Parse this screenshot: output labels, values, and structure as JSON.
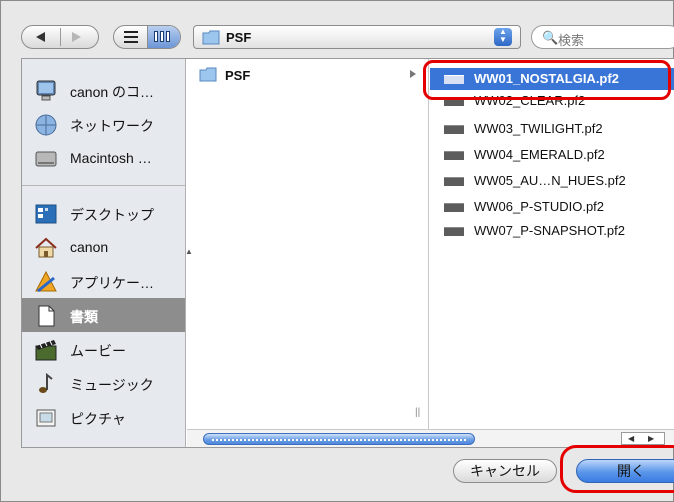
{
  "toolbar": {
    "path_folder": "PSF",
    "search_placeholder": "検索"
  },
  "sidebar": {
    "items": [
      {
        "label": "canon のコ…",
        "icon": "computer-icon"
      },
      {
        "label": "ネットワーク",
        "icon": "network-icon"
      },
      {
        "label": "Macintosh …",
        "icon": "hard-drive-icon"
      },
      {
        "label": "デスクトップ",
        "icon": "desktop-icon"
      },
      {
        "label": "canon",
        "icon": "home-icon"
      },
      {
        "label": "アプリケー…",
        "icon": "applications-icon"
      },
      {
        "label": "書類",
        "icon": "documents-icon",
        "selected": true
      },
      {
        "label": "ムービー",
        "icon": "movies-icon"
      },
      {
        "label": "ミュージック",
        "icon": "music-icon"
      },
      {
        "label": "ピクチャ",
        "icon": "pictures-icon"
      }
    ]
  },
  "column1": {
    "folder": "PSF"
  },
  "column2": {
    "files": [
      {
        "name": "WW01_NOSTALGIA.pf2",
        "selected": true
      },
      {
        "name": "WW02_CLEAR.pf2"
      },
      {
        "name": "WW03_TWILIGHT.pf2"
      },
      {
        "name": "WW04_EMERALD.pf2"
      },
      {
        "name": "WW05_AU…N_HUES.pf2"
      },
      {
        "name": "WW06_P-STUDIO.pf2"
      },
      {
        "name": "WW07_P-SNAPSHOT.pf2"
      }
    ]
  },
  "buttons": {
    "cancel": "キャンセル",
    "open": "開く"
  },
  "colors": {
    "selection": "#3875d7",
    "highlight": "#e50000",
    "sidebar_selected": "#8d8d8d"
  }
}
